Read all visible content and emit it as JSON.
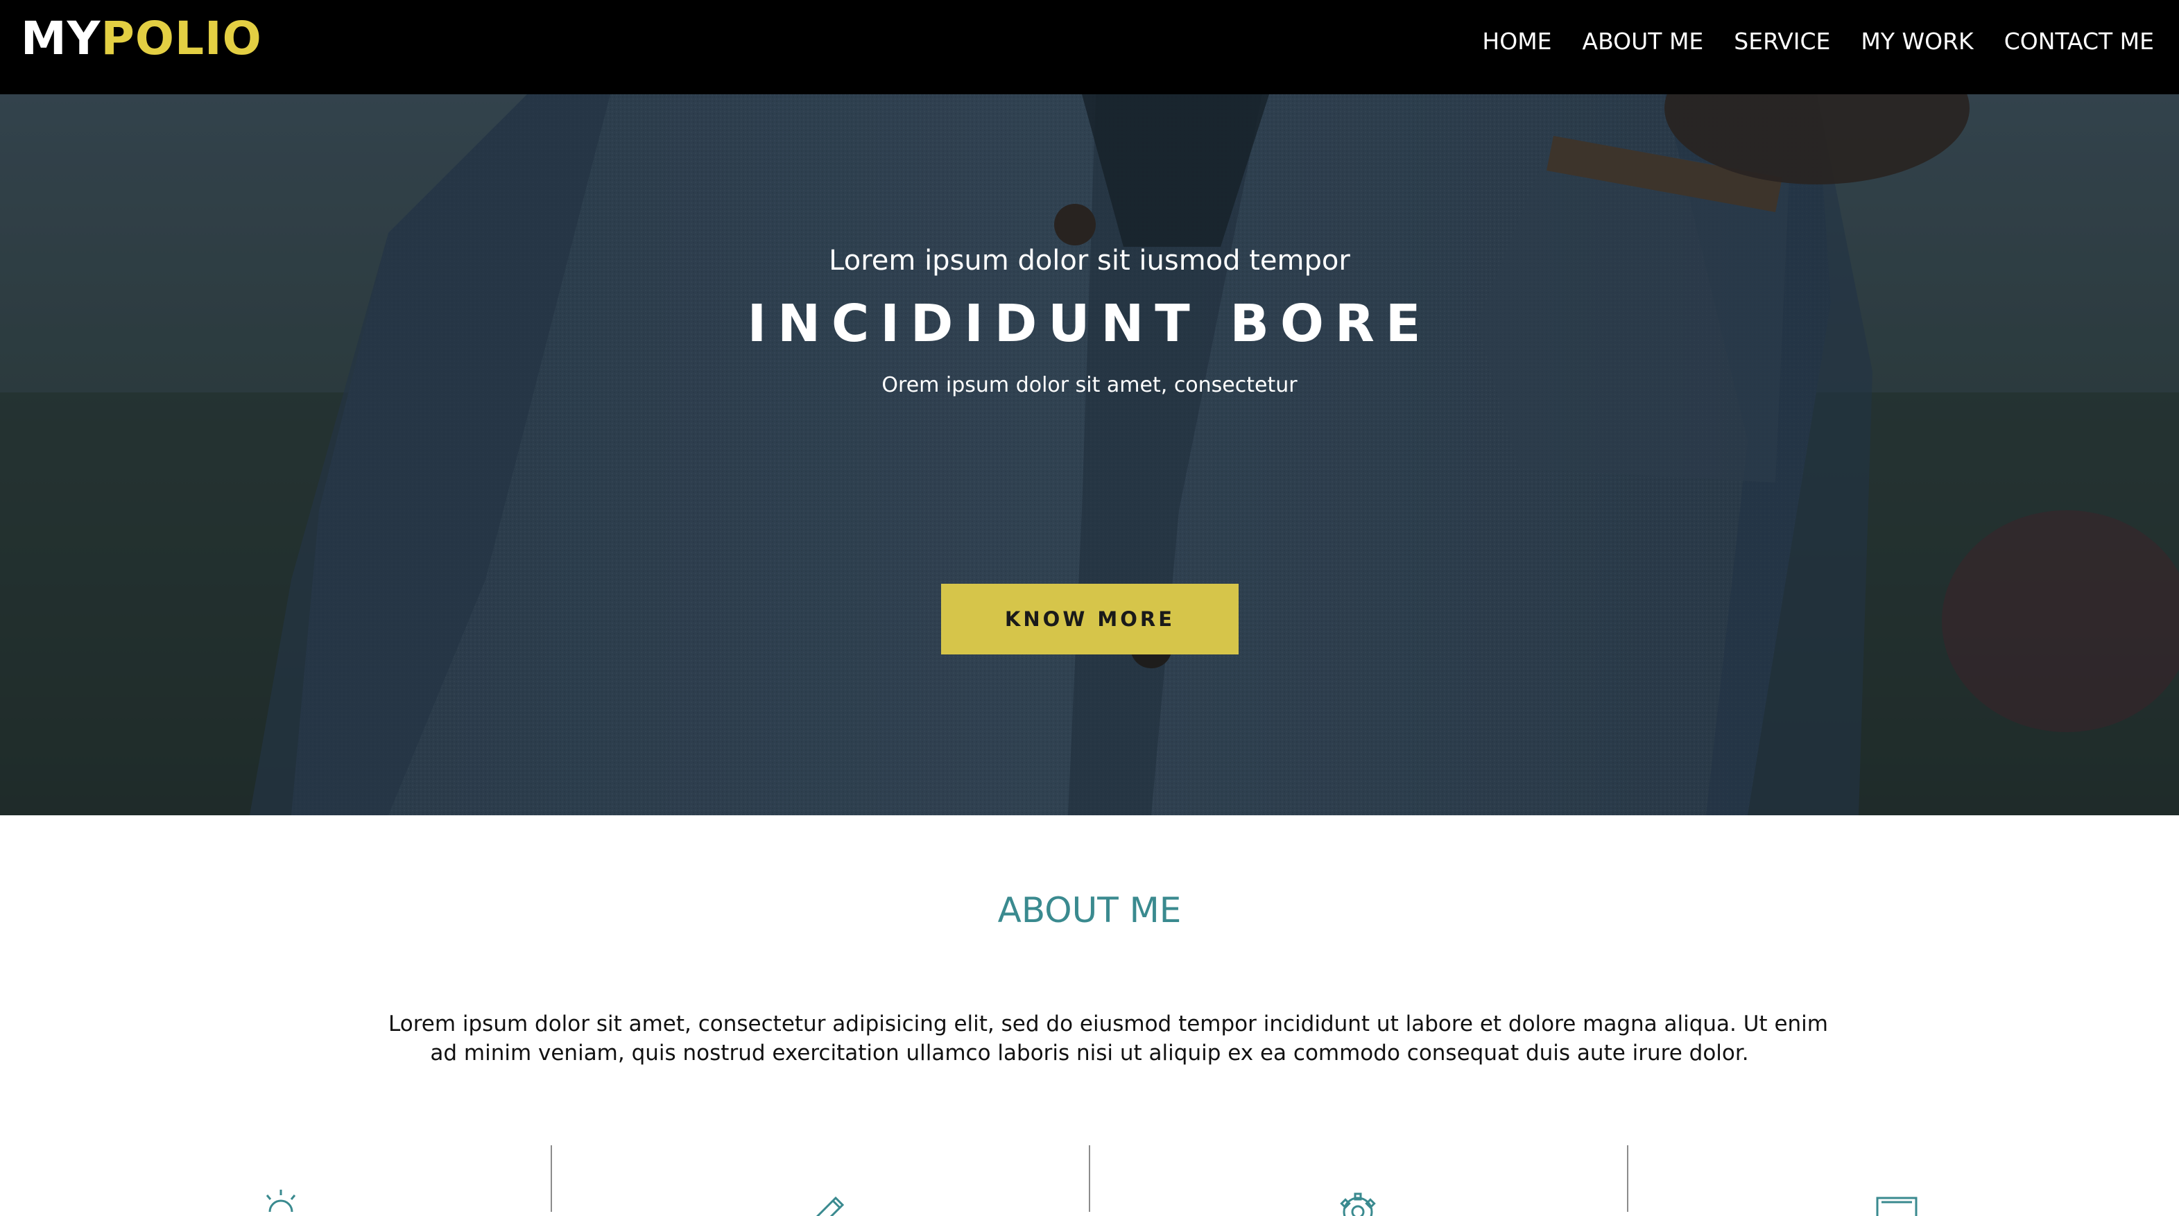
{
  "brand": {
    "part1": "MY",
    "part2": "POLIO"
  },
  "nav": {
    "items": [
      {
        "label": "HOME"
      },
      {
        "label": "ABOUT ME"
      },
      {
        "label": "SERVICE"
      },
      {
        "label": "MY WORK"
      },
      {
        "label": "CONTACT ME"
      }
    ]
  },
  "hero": {
    "subtitle": "Lorem ipsum dolor sit iusmod tempor",
    "title": "INCIDIDUNT BORE",
    "description": "Orem ipsum dolor sit amet, consectetur",
    "button_label": "KNOW MORE"
  },
  "about": {
    "title": "ABOUT ME",
    "text_line1": "Lorem ipsum dolor sit amet, consectetur adipisicing elit, sed do eiusmod tempor incididunt ut labore et dolore magna aliqua. Ut enim",
    "text_line2": "ad minim veniam, quis nostrud exercitation ullamco laboris nisi ut aliquip ex ea commodo consequat duis aute irure dolor."
  },
  "features": {
    "icons": [
      "lightbulb-icon",
      "pencil-icon",
      "gear-icon",
      "monitor-icon"
    ]
  },
  "colors": {
    "nav_background": "#000000",
    "brand_accent": "#e3cf43",
    "button_background": "#d6c54a",
    "section_title": "#3a8a8f",
    "icon_color": "#3a8a8f"
  }
}
